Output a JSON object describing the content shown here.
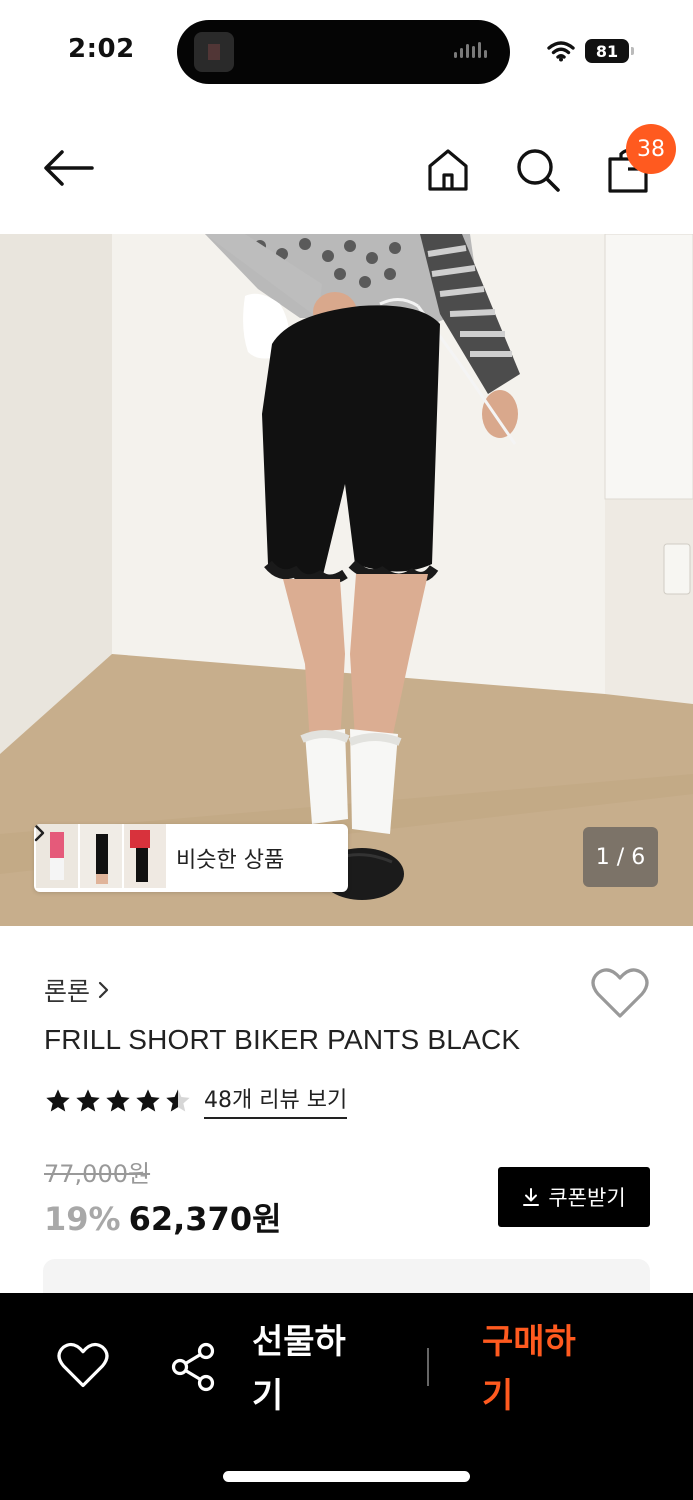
{
  "status_bar": {
    "time": "2:02",
    "battery": "81"
  },
  "header": {
    "cart_count": "38",
    "icons": [
      "back-arrow-icon",
      "home-icon",
      "search-icon",
      "shopping-bag-icon"
    ]
  },
  "gallery": {
    "similar_label": "비슷한 상품",
    "page_indicator": "1 / 6"
  },
  "product": {
    "brand": "론론",
    "title": "FRILL SHORT BIKER PANTS BLACK",
    "rating": 4.5,
    "review_link": "48개 리뷰 보기",
    "original_price": "77,000원",
    "discount": "19%",
    "sale_price": "62,370원",
    "coupon_label": "쿠폰받기"
  },
  "bottom_bar": {
    "gift_label": "선물하기",
    "buy_label": "구매하기"
  },
  "colors": {
    "accent": "#ff5a1f",
    "bottom_bar_bg": "#000000",
    "discount_gray": "#a8a8a8"
  }
}
